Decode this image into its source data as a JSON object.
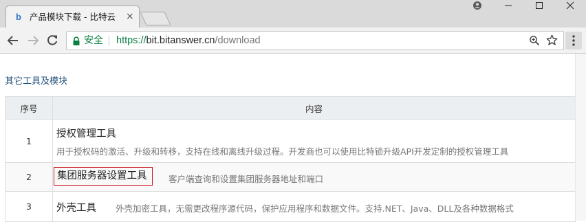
{
  "browser": {
    "tab": {
      "favicon": "b",
      "title": "产品模块下载 - 比特云",
      "close": "×"
    },
    "window_controls": [
      "profile-icon",
      "minimize-icon",
      "maximize-icon",
      "close-icon"
    ],
    "address": {
      "secure_label": "安全",
      "url_scheme": "https://",
      "url_host": "bit.bitanswer.cn",
      "url_path": "/download"
    },
    "colors": {
      "secure_green": "#0b8043",
      "link_blue": "#23527c",
      "highlight_red": "#c8161d"
    }
  },
  "page": {
    "section_title": "其它工具及模块",
    "table": {
      "headers": [
        "序号",
        "内容"
      ],
      "rows": [
        {
          "no": "1",
          "name": "授权管理工具",
          "desc": "用于授权码的激活、升级和转移，支持在线和离线升级过程。开发商也可以使用比特锁升级API开发定制的授权管理工具"
        },
        {
          "no": "2",
          "name": "集团服务器设置工具",
          "desc": "客户端查询和设置集团服务器地址和端口",
          "highlighted": true
        },
        {
          "no": "3",
          "name": "外壳工具",
          "desc": "外壳加密工具，无需更改程序源代码，保护应用程序和数据文件。支持.NET、Java、DLL及各种数据格式"
        }
      ]
    }
  }
}
